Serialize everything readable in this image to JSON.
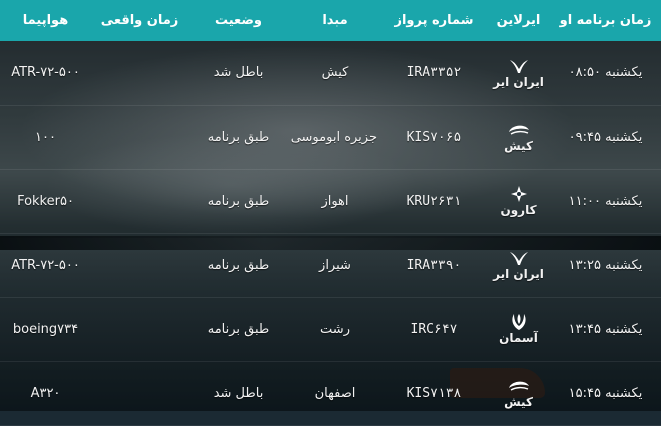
{
  "header": {
    "time": "زمان برنامه او",
    "airline": "ایرلاین",
    "flight": "شماره پرواز",
    "origin": "مبدا",
    "status": "وضعیت",
    "actual": "زمان واقعی",
    "plane": "هواپیما"
  },
  "rows": [
    {
      "time": "یکشنبه ۰۸:۵۰",
      "airline_icon": "iran-air-homa-icon",
      "airline": "ایران ایر",
      "flight": "IRA۳۳۵۲",
      "origin": "کیش",
      "status": "باطل شد",
      "actual": "",
      "plane": "ATR-۷۲-۵۰۰"
    },
    {
      "time": "یکشنبه ۰۹:۴۵",
      "airline_icon": "kish-air-icon",
      "airline": "کیش",
      "flight": "KIS۷۰۶۵",
      "origin": "جزیره ابوموسی",
      "status": "طبق برنامه",
      "actual": "",
      "plane": "۱۰۰"
    },
    {
      "time": "یکشنبه ۱۱:۰۰",
      "airline_icon": "karun-airline-icon",
      "airline": "کارون",
      "flight": "KRU۲۶۳۱",
      "origin": "اهواز",
      "status": "طبق برنامه",
      "actual": "",
      "plane": "Fokker۵۰"
    },
    {
      "time": "یکشنبه ۱۳:۲۵",
      "airline_icon": "iran-air-homa-icon",
      "airline": "ایران ایر",
      "flight": "IRA۳۳۹۰",
      "origin": "شیراز",
      "status": "طبق برنامه",
      "actual": "",
      "plane": "ATR-۷۲-۵۰۰"
    },
    {
      "time": "یکشنبه ۱۳:۴۵",
      "airline_icon": "aseman-airline-icon",
      "airline": "آسمان",
      "flight": "IRC۶۴۷",
      "origin": "رشت",
      "status": "طبق برنامه",
      "actual": "",
      "plane": "boeing۷۳۴"
    },
    {
      "time": "یکشنبه ۱۵:۴۵",
      "airline_icon": "kish-air-icon",
      "airline": "کیش",
      "flight": "KIS۷۱۳۸",
      "origin": "اصفهان",
      "status": "باطل شد",
      "actual": "",
      "plane": "A۳۲۰"
    }
  ]
}
